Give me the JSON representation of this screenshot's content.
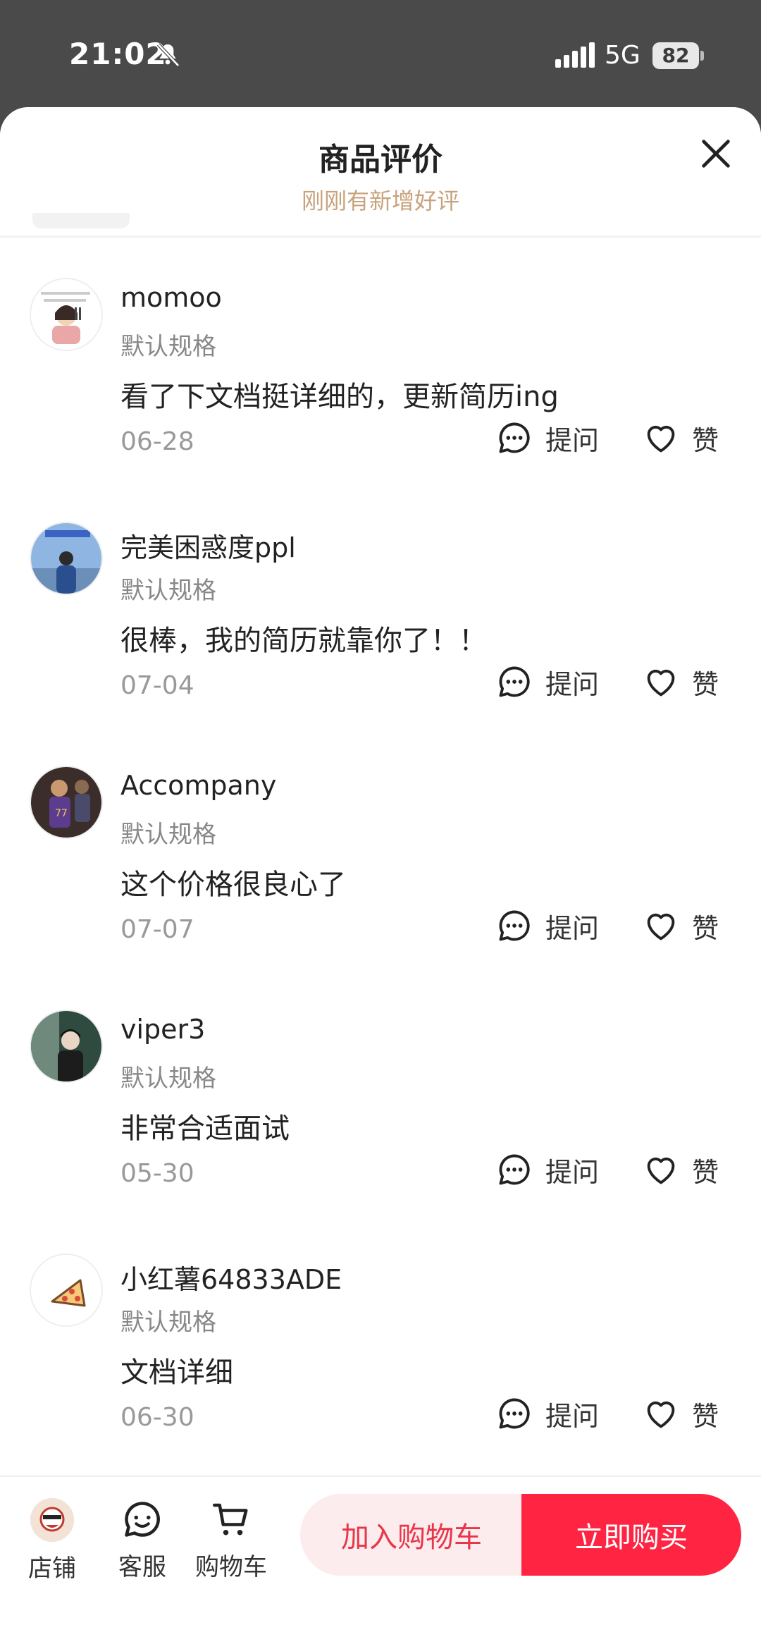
{
  "status_bar": {
    "time": "21:02",
    "network": "5G",
    "battery": "82",
    "icons": [
      "bell-muted-icon",
      "signal-icon",
      "battery-icon"
    ]
  },
  "sheet": {
    "title": "商品评价",
    "subtitle": "刚刚有新增好评",
    "close_icon": "close-icon"
  },
  "reviews": [
    {
      "username": "momoo",
      "spec": "默认规格",
      "content": "看了下文档挺详细的，更新简历ing",
      "date": "06-28",
      "ask_label": "提问",
      "like_label": "赞"
    },
    {
      "username": "完美困惑度ppl",
      "spec": "默认规格",
      "content": "很棒，我的简历就靠你了！！",
      "date": "07-04",
      "ask_label": "提问",
      "like_label": "赞"
    },
    {
      "username": "Accompany",
      "spec": "默认规格",
      "content": "这个价格很良心了",
      "date": "07-07",
      "ask_label": "提问",
      "like_label": "赞"
    },
    {
      "username": "viper3",
      "spec": "默认规格",
      "content": "非常合适面试",
      "date": "05-30",
      "ask_label": "提问",
      "like_label": "赞"
    },
    {
      "username": "小红薯64833ADE",
      "spec": "默认规格",
      "content": "文档详细",
      "date": "06-30",
      "ask_label": "提问",
      "like_label": "赞"
    }
  ],
  "bottom_bar": {
    "store_label": "店铺",
    "service_label": "客服",
    "cart_label": "购物车",
    "add_to_cart": "加入购物车",
    "buy_now": "立即购买",
    "colors": {
      "accent": "#ff2442",
      "cart_bg": "#fdeced",
      "cart_text": "#e8354a"
    }
  }
}
